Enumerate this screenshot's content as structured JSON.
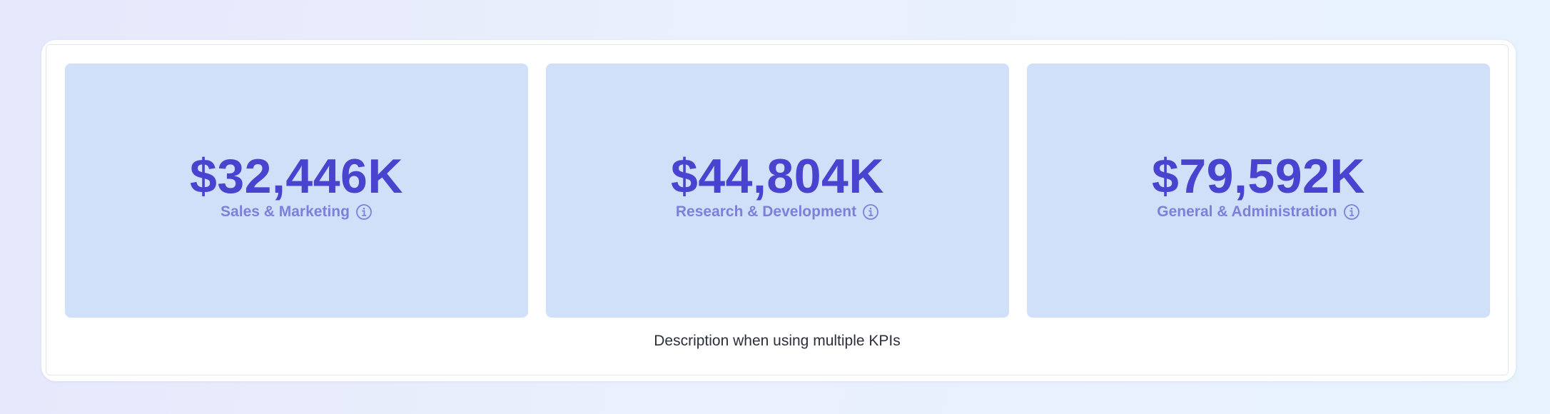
{
  "kpis": [
    {
      "value": "$32,446K",
      "label": "Sales & Marketing",
      "icon": "info-icon"
    },
    {
      "value": "$44,804K",
      "label": "Research & Development",
      "icon": "info-icon"
    },
    {
      "value": "$79,592K",
      "label": "General & Administration",
      "icon": "info-icon"
    }
  ],
  "description": "Description when using multiple KPIs",
  "colors": {
    "kpi_background": "#d1e0f9",
    "kpi_value": "#4a43cf",
    "kpi_label": "#7c80db",
    "description_text": "#2a2f3a"
  }
}
